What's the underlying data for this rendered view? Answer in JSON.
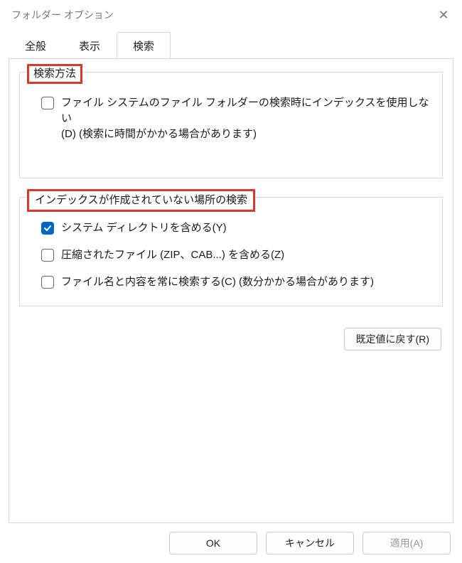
{
  "window": {
    "title": "フォルダー オプション"
  },
  "tabs": [
    {
      "label": "全般",
      "active": false
    },
    {
      "label": "表示",
      "active": false
    },
    {
      "label": "検索",
      "active": true
    }
  ],
  "group1": {
    "legend": "検索方法",
    "opt_noindex_line1": "ファイル システムのファイル フォルダーの検索時にインデックスを使用しない",
    "opt_noindex_line2": "(D) (検索に時間がかかる場合があります)",
    "opt_noindex_checked": false
  },
  "group2": {
    "legend": "インデックスが作成されていない場所の検索",
    "opt_sysdir_label": "システム ディレクトリを含める(Y)",
    "opt_sysdir_checked": true,
    "opt_zip_label": "圧縮されたファイル (ZIP、CAB...) を含める(Z)",
    "opt_zip_checked": false,
    "opt_content_label": "ファイル名と内容を常に検索する(C) (数分かかる場合があります)",
    "opt_content_checked": false
  },
  "buttons": {
    "restore": "既定値に戻す(R)",
    "ok": "OK",
    "cancel": "キャンセル",
    "apply": "適用(A)"
  },
  "highlight_color": "#d63b2e"
}
